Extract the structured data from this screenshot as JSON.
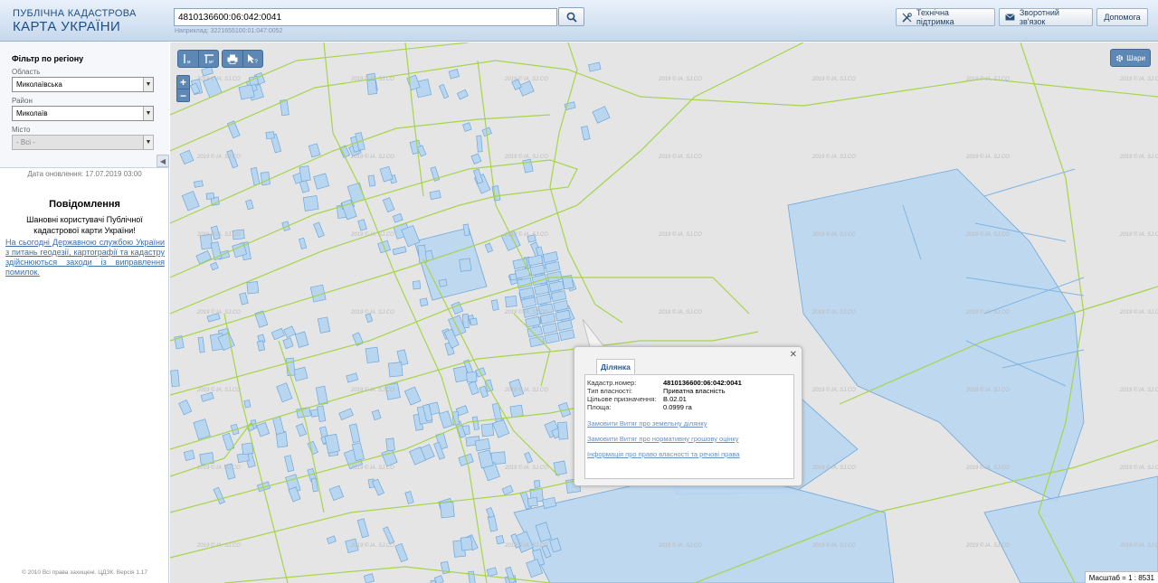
{
  "header": {
    "logo_line1": "ПУБЛІЧНА КАДАСТРОВА",
    "logo_line2": "КАРТА УКРАЇНИ",
    "search_value": "4810136600:06:042:0041",
    "search_hint": "Наприклад: 3221655100:01:047:0052",
    "buttons": {
      "support": "Технічна підтримка",
      "feedback": "Зворотний зв'язок",
      "help": "Допомога"
    }
  },
  "sidebar": {
    "filter_title": "Фільтр по регіону",
    "oblast_label": "Область",
    "oblast_value": "Миколаївська",
    "raion_label": "Район",
    "raion_value": "Миколаїв",
    "misto_label": "Місто",
    "misto_value": "- Всі -",
    "update_date": "Дата оновлення: 17.07.2019 03:00",
    "message_title": "Повідомлення",
    "message_greeting": "Шановні користувачі Публічної кадастрової карти України!",
    "message_link": "На сьогодні Державною службою України з питань геодезії, картографії та кадастру здійснюються заходи із виправлення помилок.",
    "copyright": "© 2010 Всі права захищені. ЦДЗК. Версія 1.17"
  },
  "map": {
    "tools": [
      "distance-tool",
      "area-tool",
      "print-tool",
      "identify-tool"
    ],
    "zoom_in": "+",
    "zoom_out": "−",
    "layers_label": "Шари",
    "scale_text": "Масштаб = 1 : 8531",
    "watermark": "2019 © ІА. SJ.CO",
    "colors": {
      "parcel_fill": "#b9d6f0",
      "parcel_stroke": "#6fa7d9",
      "boundary": "#a7d44a",
      "map_bg": "#e5e5e5"
    }
  },
  "popup": {
    "tab": "Ділянка",
    "rows": [
      {
        "key": "Кадастр.номер:",
        "value": "4810136600:06:042:0041"
      },
      {
        "key": "Тип власності:",
        "value": "Приватна власність"
      },
      {
        "key": "Цільове призначення:",
        "value": "В.02.01"
      },
      {
        "key": "Площа:",
        "value": "0.0999 га"
      }
    ],
    "links": [
      "Замовити Витяг про земельну ділянку",
      "Замовити Витяг про нормативну грошову оцінку",
      "Інформація про право власності та речові права"
    ]
  }
}
